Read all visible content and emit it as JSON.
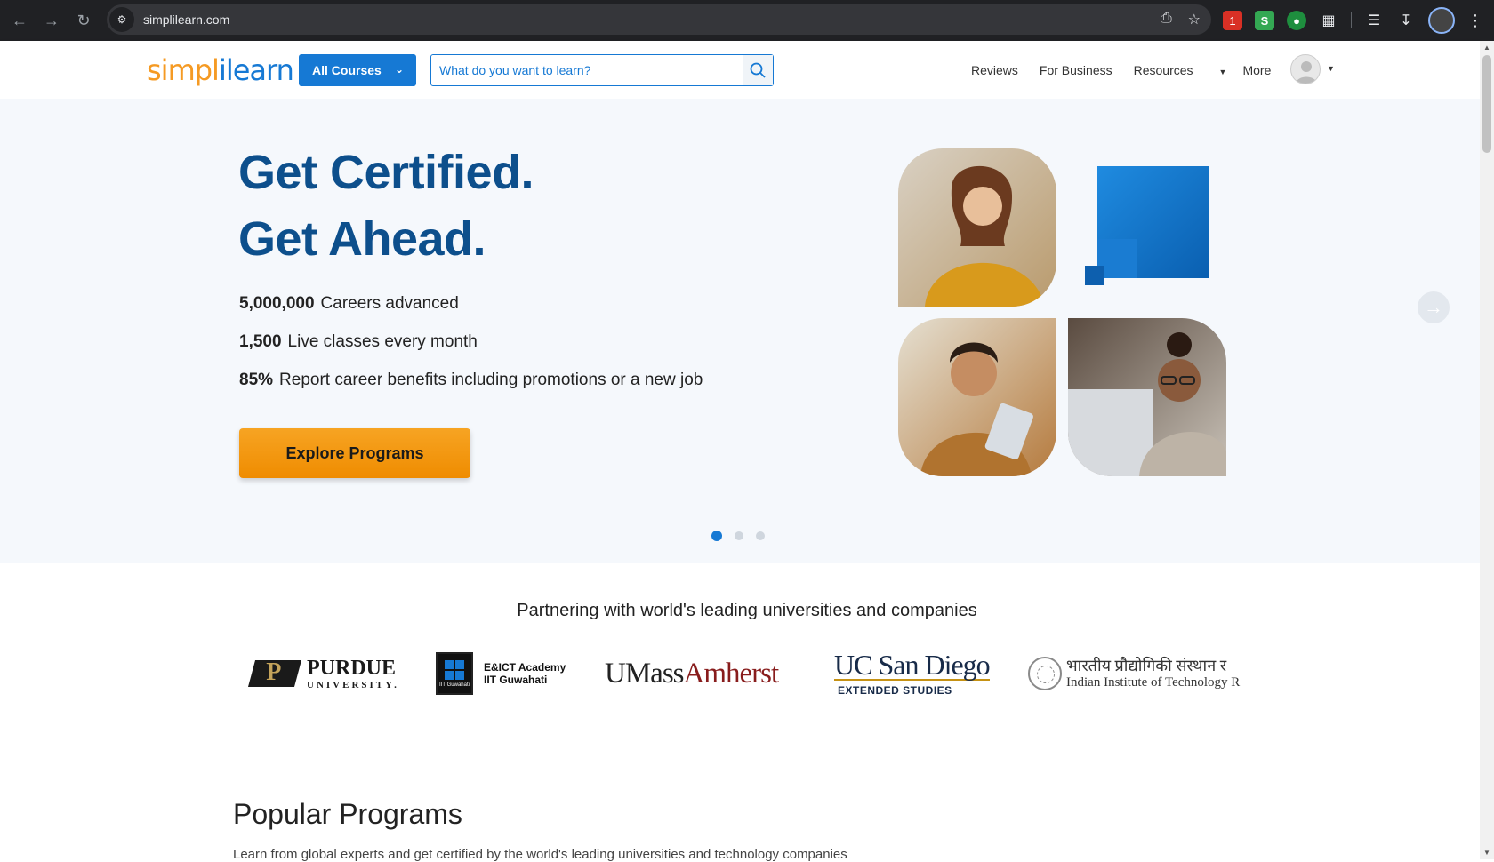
{
  "browser": {
    "url": "simplilearn.com",
    "ext_badge": "1"
  },
  "header": {
    "logo_part1": "simpl",
    "logo_part2": "ilearn",
    "all_courses_label": "All Courses",
    "search_placeholder": "What do you want to learn?",
    "links": {
      "reviews": "Reviews",
      "for_business": "For Business",
      "resources": "Resources",
      "more": "More"
    }
  },
  "hero": {
    "title_line1": "Get Certified.",
    "title_line2": "Get Ahead.",
    "stats": [
      {
        "value": "5,000,000",
        "label": "Careers advanced"
      },
      {
        "value": "1,500",
        "label": "Live classes every month"
      },
      {
        "value": "85%",
        "label": "Report career benefits including promotions or a new job"
      }
    ],
    "cta_label": "Explore Programs",
    "carousel_active_index": 0,
    "carousel_count": 3
  },
  "partners": {
    "title": "Partnering with world's leading universities and companies",
    "purdue_big": "PURDUE",
    "purdue_small": "UNIVERSITY.",
    "eict_line1": "E&ICT Academy",
    "eict_line2": "IIT Guwahati",
    "eict_badge": "IIT Guwahati",
    "umass_u": "UMass",
    "umass_a": "Amherst",
    "ucsd_title": "UC San Diego",
    "ucsd_sub": "EXTENDED STUDIES",
    "iit_hindi": "भारतीय प्रौद्योगिकी संस्थान र",
    "iit_english": "Indian Institute of Technology R"
  },
  "popular": {
    "title": "Popular Programs",
    "subtitle": "Learn from global experts and get certified by the world's leading universities and technology companies"
  },
  "colors": {
    "brand_blue": "#1679d4",
    "brand_orange": "#f59a23",
    "hero_title": "#0d4f8c",
    "cta": "#f39a1a"
  }
}
